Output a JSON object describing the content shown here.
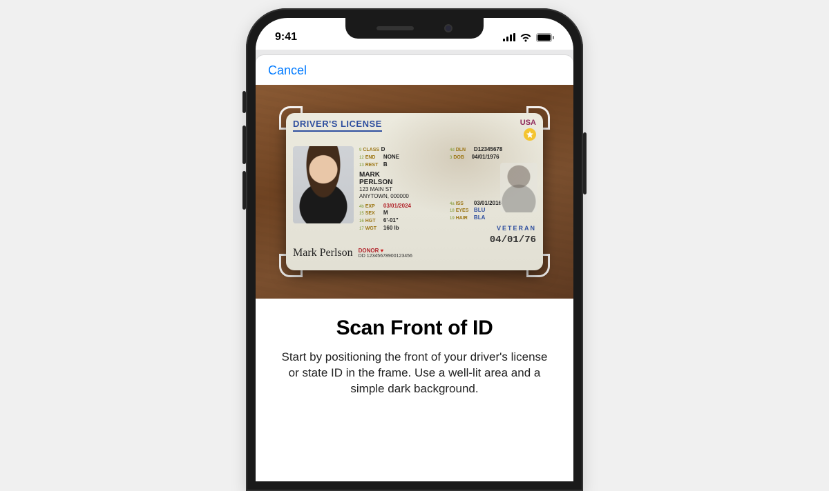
{
  "status": {
    "time": "9:41"
  },
  "nav": {
    "cancel": "Cancel"
  },
  "main": {
    "title": "Scan Front of ID",
    "body": "Start by positioning the front of your driver's license or state ID in the frame. Use a well-lit area and a simple dark background."
  },
  "license": {
    "title": "DRIVER'S LICENSE",
    "country": "USA",
    "class_label": "CLASS",
    "class_value": "D",
    "end_label": "END",
    "end_value": "NONE",
    "rest_label": "REST",
    "rest_value": "B",
    "dln_label": "DLN",
    "dln_value": "D12345678",
    "dob_label": "DOB",
    "dob_value": "04/01/1976",
    "name_first": "MARK",
    "name_last": "PERLSON",
    "addr1": "123 MAIN ST",
    "addr2": "ANYTOWN, 000000",
    "exp_label": "EXP",
    "exp_value": "03/01/2024",
    "iss_label": "ISS",
    "iss_value": "03/01/2016",
    "sex_label": "SEX",
    "sex_value": "M",
    "hgt_label": "HGT",
    "hgt_value": "6'-01\"",
    "wgt_label": "WGT",
    "wgt_value": "160 lb",
    "eyes_label": "EYES",
    "eyes_value": "BLU",
    "hair_label": "HAIR",
    "hair_value": "BLA",
    "veteran": "VETERAN",
    "big_date": "04/01/76",
    "signature": "Mark Perlson",
    "donor": "DONOR",
    "dd_label": "DD",
    "dd_value": "12345678900123456"
  }
}
